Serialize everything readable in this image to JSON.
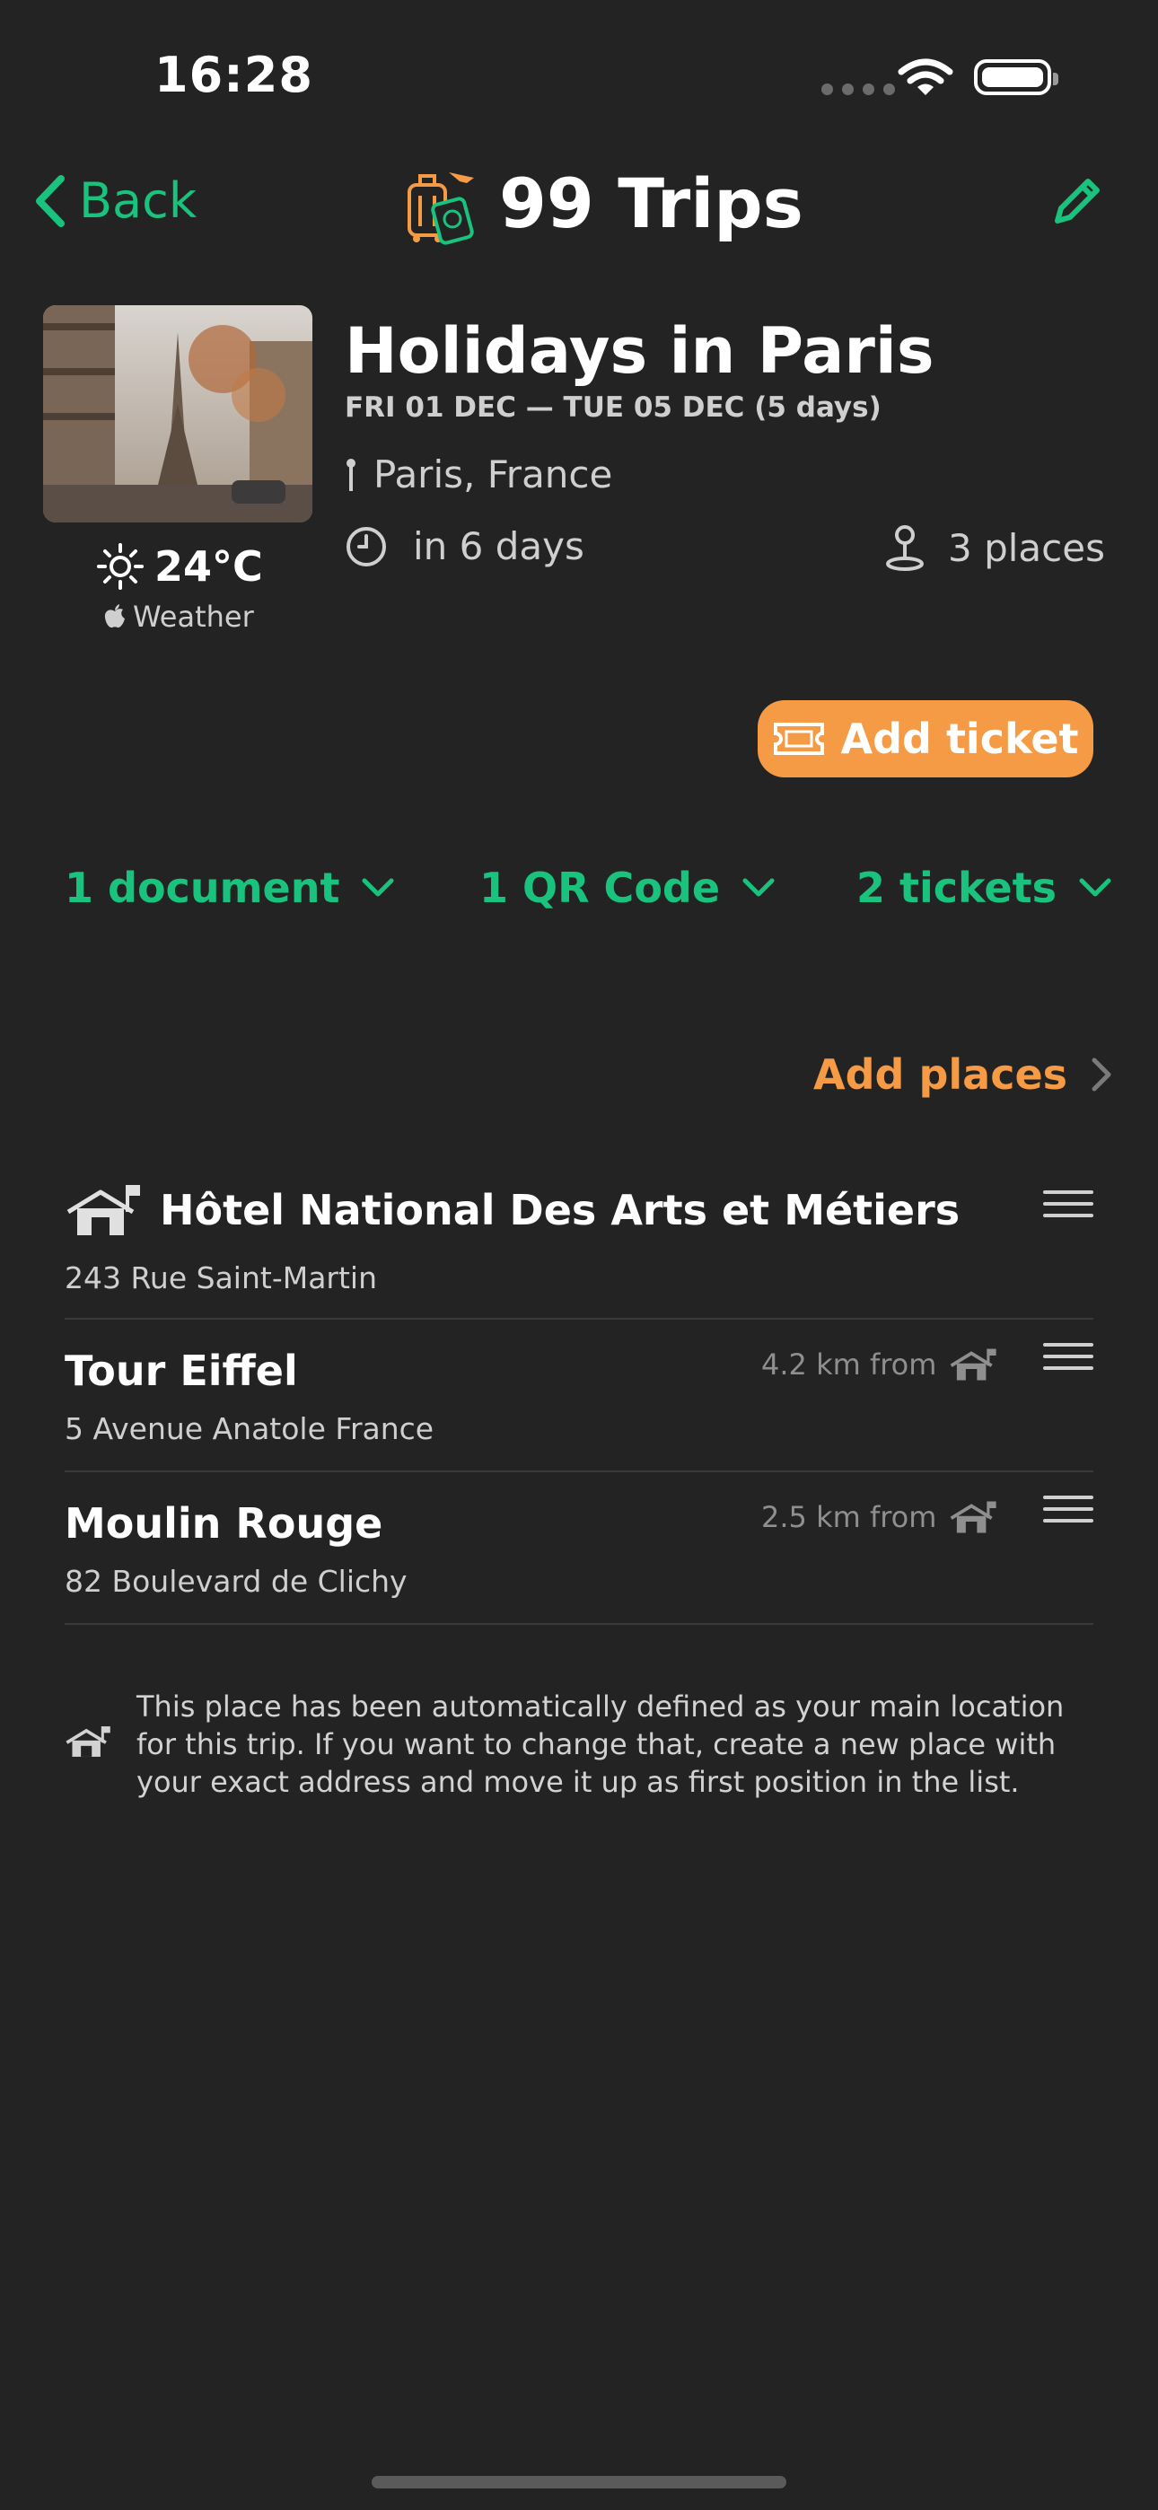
{
  "status_bar": {
    "time": "16:28"
  },
  "nav": {
    "back_label": "Back",
    "app_title": "99 Trips"
  },
  "trip": {
    "title": "Holidays in Paris",
    "dates": "FRI 01 DEC — TUE 05 DEC  (5 days)",
    "location": "Paris, France",
    "countdown": "in 6 days",
    "places_count": "3 places",
    "weather_temp": "24°C",
    "weather_source": "Weather"
  },
  "actions": {
    "add_ticket": "Add ticket",
    "add_places": "Add places"
  },
  "expanders": {
    "documents": "1 document",
    "qr_codes": "1 QR Code",
    "tickets": "2 tickets"
  },
  "places": [
    {
      "name": "Hôtel National Des Arts et Métiers",
      "address": "243 Rue Saint-Martin",
      "distance": ""
    },
    {
      "name": "Tour Eiffel",
      "address": "5 Avenue Anatole France",
      "distance": "4.2 km from"
    },
    {
      "name": "Moulin Rouge",
      "address": "82 Boulevard de Clichy",
      "distance": "2.5 km from"
    }
  ],
  "note": "This place has been automatically defined as your main location for this trip. If you want to change that, create a new place with your exact address and move it up as first position in the list.",
  "colors": {
    "accent_green": "#19c37d",
    "accent_orange": "#f59a45",
    "background": "#232323"
  },
  "icons": [
    "chevron-left-icon",
    "pencil-icon",
    "luggage-icon",
    "sun-icon",
    "apple-icon",
    "pin-icon",
    "clock-icon",
    "map-pin-icon",
    "ticket-icon",
    "chevron-down-icon",
    "chevron-right-icon",
    "home-flag-icon",
    "drag-handle-icon"
  ]
}
